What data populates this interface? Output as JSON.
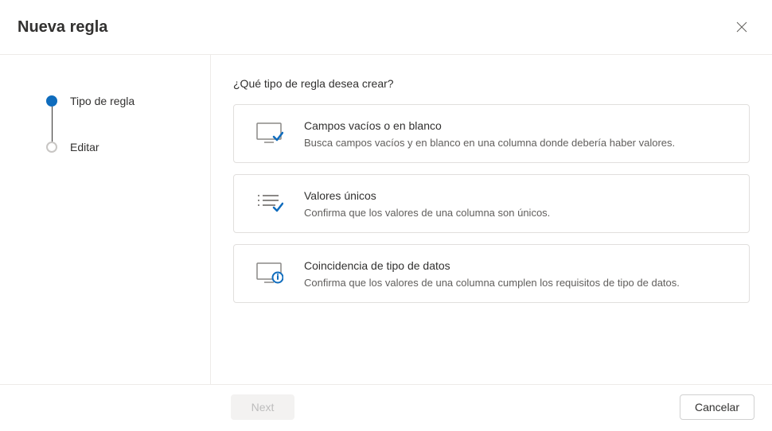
{
  "header": {
    "title": "Nueva regla"
  },
  "sidebar": {
    "steps": [
      {
        "label": "Tipo de regla",
        "active": true
      },
      {
        "label": "Editar",
        "active": false
      }
    ]
  },
  "content": {
    "question": "¿Qué tipo de regla desea crear?",
    "options": [
      {
        "icon": "screen-check-icon",
        "title": "Campos vacíos o en blanco",
        "description": "Busca campos vacíos y en blanco en una columna donde debería haber valores."
      },
      {
        "icon": "list-check-icon",
        "title": "Valores únicos",
        "description": "Confirma que los valores de una columna son únicos."
      },
      {
        "icon": "screen-info-icon",
        "title": "Coincidencia de tipo de datos",
        "description": "Confirma que los valores de una columna cumplen los requisitos de tipo de datos."
      }
    ]
  },
  "footer": {
    "next_label": "Next",
    "cancel_label": "Cancelar"
  }
}
